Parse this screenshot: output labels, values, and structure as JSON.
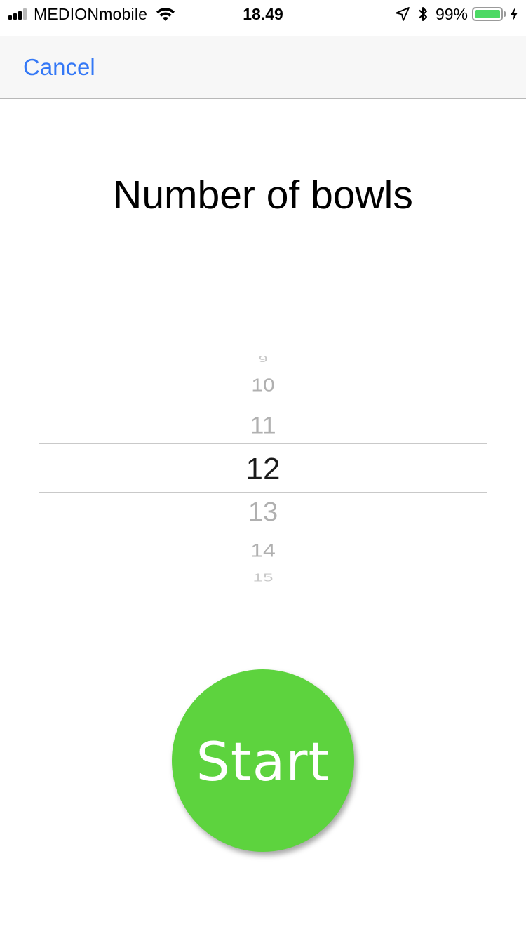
{
  "status_bar": {
    "carrier": "MEDIONmobile",
    "time": "18.49",
    "battery_percent": "99%",
    "battery_level": 0.99,
    "signal_bars_filled": 3,
    "signal_bars_total": 4,
    "icons": [
      "signal-icon",
      "wifi-icon",
      "location-icon",
      "bluetooth-icon",
      "battery-icon",
      "charging-icon"
    ]
  },
  "nav": {
    "cancel_label": "Cancel"
  },
  "title": "Number of bowls",
  "picker": {
    "selected": "12",
    "items_above": [
      "10",
      "11"
    ],
    "items_below": [
      "13",
      "14"
    ],
    "faded_above": "9",
    "faded_below": "15"
  },
  "start_button": {
    "label": "Start",
    "color": "#5dd33e"
  },
  "colors": {
    "accent": "#3478f6",
    "nav_background": "#f7f7f7",
    "battery_fill": "#4cd964"
  }
}
